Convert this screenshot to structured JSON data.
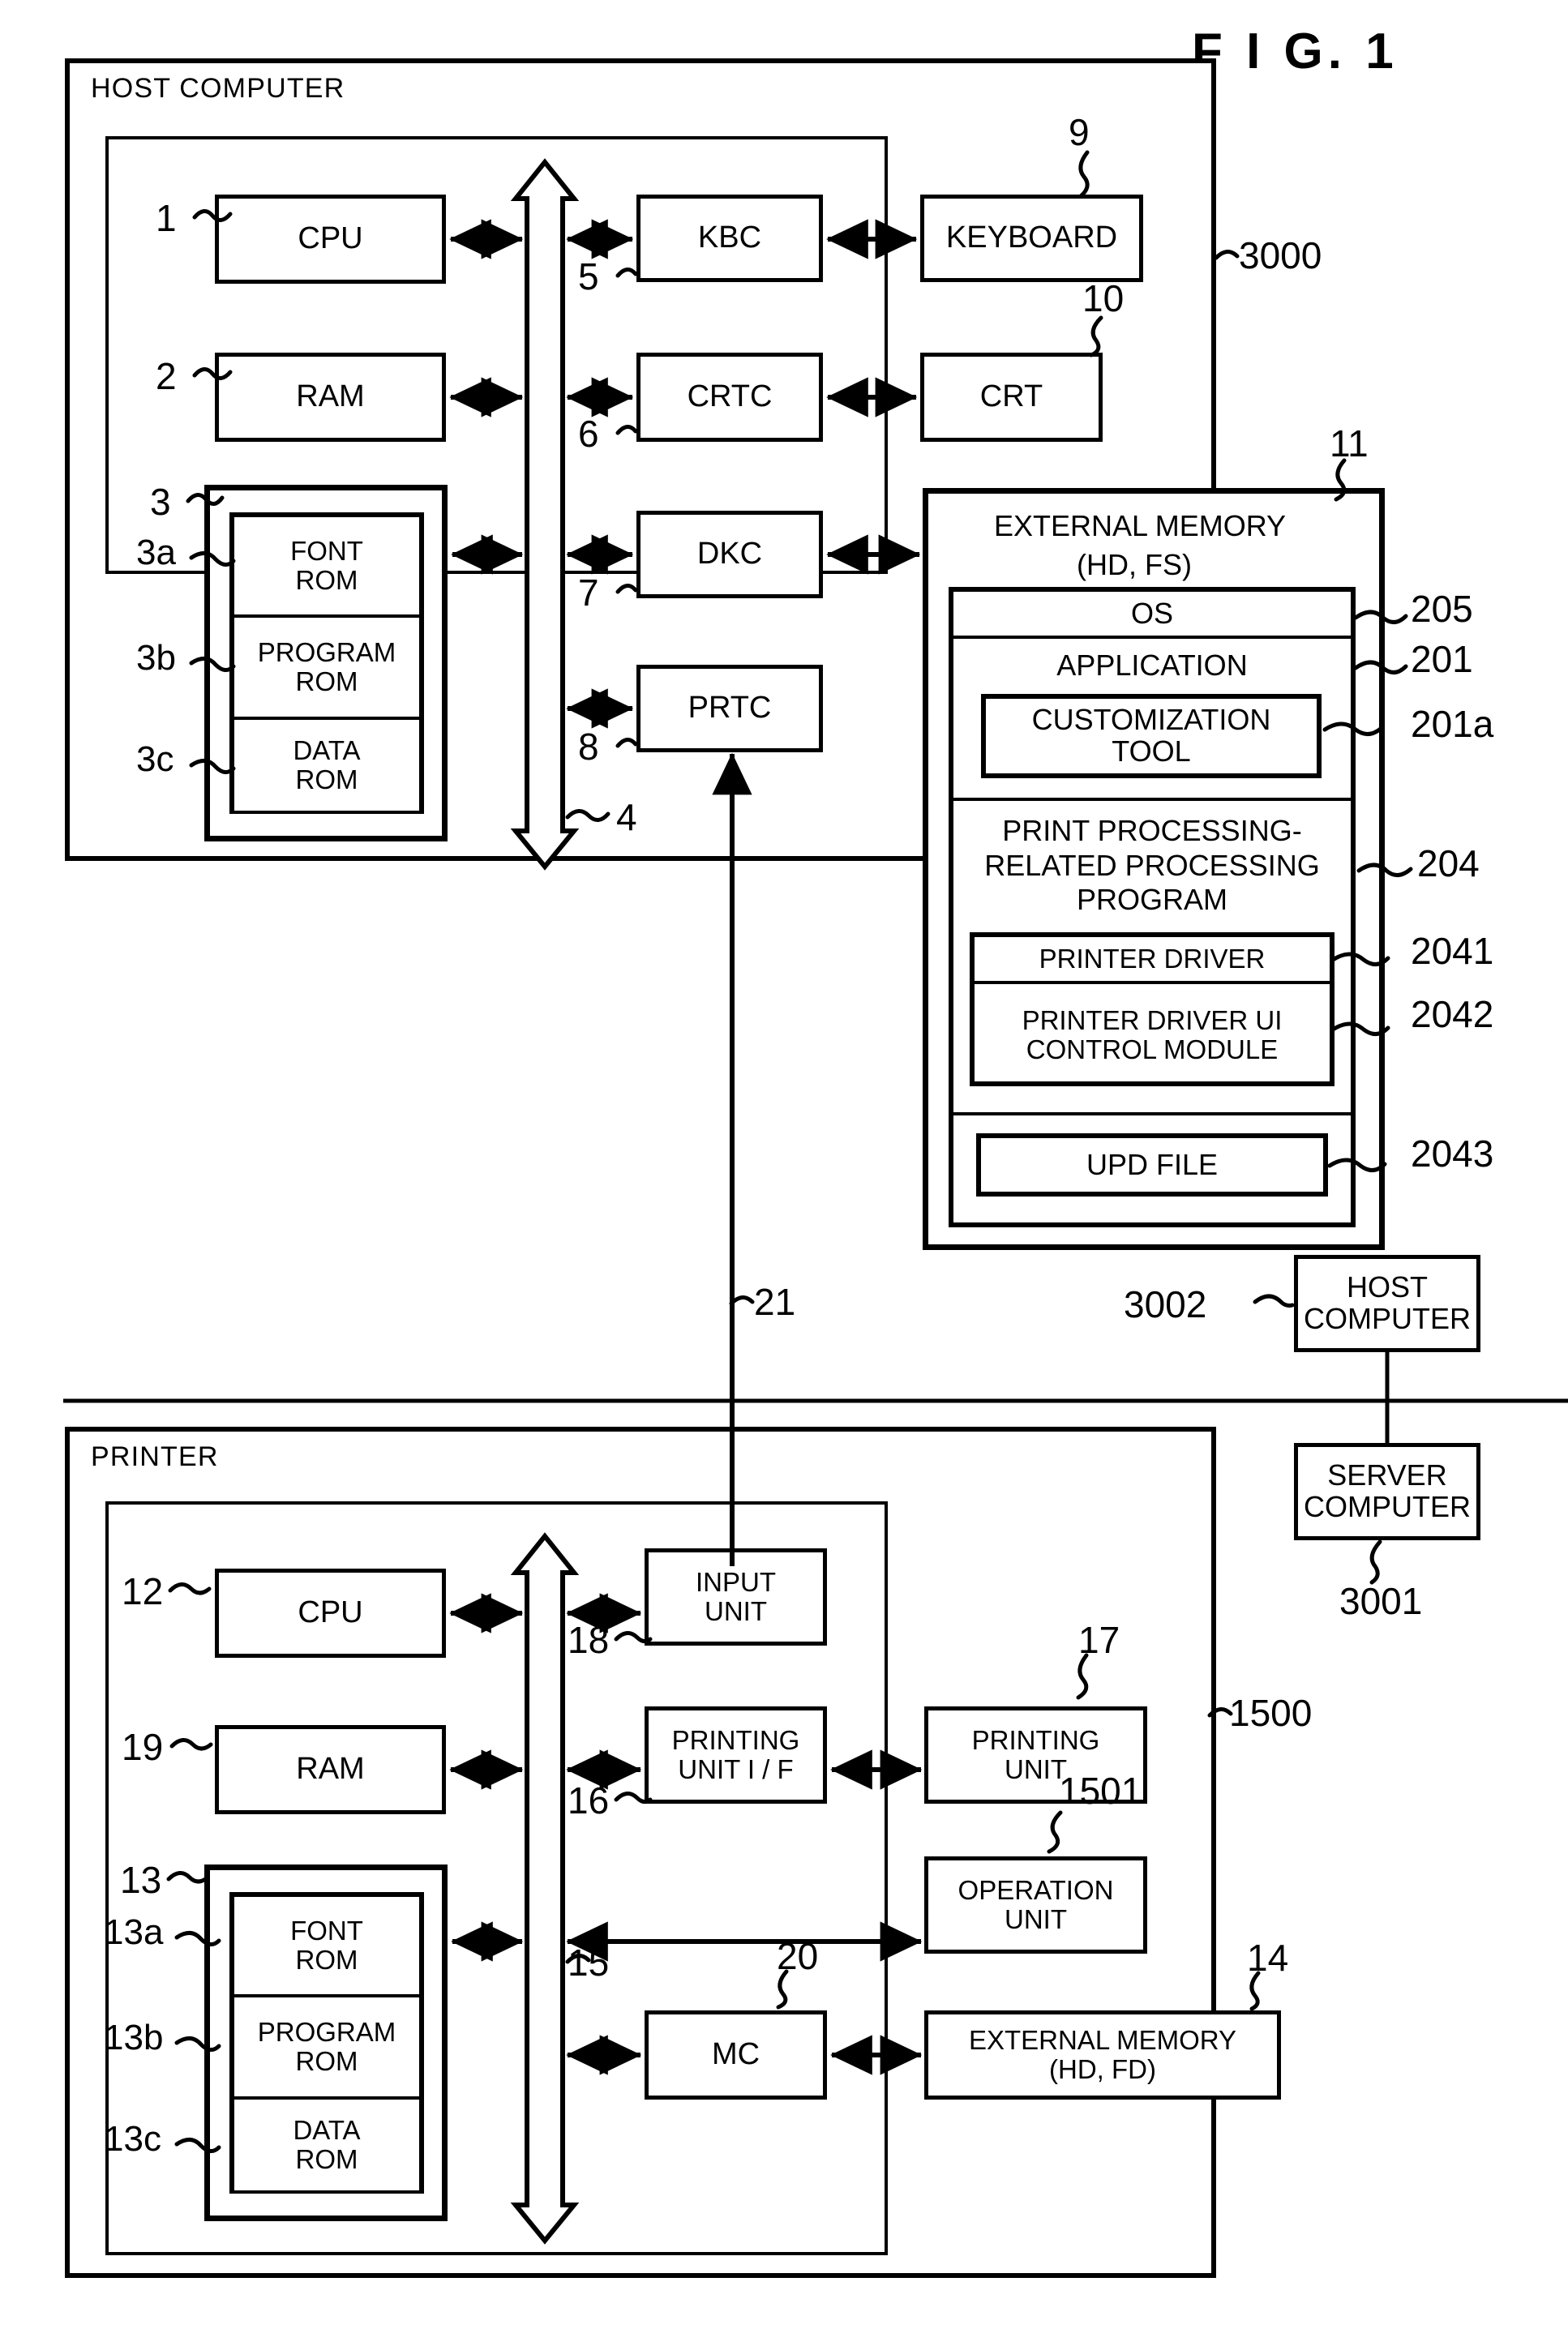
{
  "figure": {
    "title": "F I G.   1"
  },
  "host": {
    "caption": "HOST COMPUTER",
    "ref": "3000",
    "bus_ref": "4",
    "blocks": {
      "cpu": {
        "label": "CPU",
        "ref": "1"
      },
      "ram": {
        "label": "RAM",
        "ref": "2"
      },
      "rom_group_ref": "3",
      "font_rom": {
        "label": "FONT\nROM",
        "ref": "3a"
      },
      "program_rom": {
        "label": "PROGRAM\nROM",
        "ref": "3b"
      },
      "data_rom": {
        "label": "DATA\nROM",
        "ref": "3c"
      },
      "kbc": {
        "label": "KBC",
        "ref": "5"
      },
      "crtc": {
        "label": "CRTC",
        "ref": "6"
      },
      "dkc": {
        "label": "DKC",
        "ref": "7"
      },
      "prtc": {
        "label": "PRTC",
        "ref": "8"
      },
      "keyboard": {
        "label": "KEYBOARD",
        "ref": "9"
      },
      "crt": {
        "label": "CRT",
        "ref": "10"
      }
    },
    "external_memory": {
      "title_line1": "EXTERNAL MEMORY",
      "title_line2": "(HD, FS)",
      "ref": "11",
      "items": [
        {
          "label": "OS",
          "ref": "205"
        },
        {
          "label": "APPLICATION",
          "ref": "201"
        },
        {
          "label": "CUSTOMIZATION\nTOOL",
          "ref": "201a"
        },
        {
          "label": "PRINT PROCESSING-\nRELATED PROCESSING\nPROGRAM",
          "ref": "204"
        },
        {
          "label": "PRINTER DRIVER",
          "ref": "2041"
        },
        {
          "label": "PRINTER DRIVER UI\nCONTROL MODULE",
          "ref": "2042"
        },
        {
          "label": "UPD FILE",
          "ref": "2043"
        }
      ]
    }
  },
  "link": {
    "ref": "21"
  },
  "network": {
    "host_computer": {
      "label": "HOST\nCOMPUTER",
      "ref": "3002"
    },
    "server_computer": {
      "label": "SERVER\nCOMPUTER",
      "ref": "3001"
    }
  },
  "printer": {
    "caption": "PRINTER",
    "ref": "1500",
    "bus_ref": "15",
    "blocks": {
      "cpu": {
        "label": "CPU",
        "ref": "12"
      },
      "ram": {
        "label": "RAM",
        "ref": "19"
      },
      "rom_group_ref": "13",
      "font_rom": {
        "label": "FONT\nROM",
        "ref": "13a"
      },
      "program_rom": {
        "label": "PROGRAM\nROM",
        "ref": "13b"
      },
      "data_rom": {
        "label": "DATA\nROM",
        "ref": "13c"
      },
      "input_unit": {
        "label": "INPUT\nUNIT",
        "ref": "18"
      },
      "printing_unit_if": {
        "label": "PRINTING\nUNIT I / F",
        "ref": "16"
      },
      "printing_unit": {
        "label": "PRINTING\nUNIT",
        "ref": "17"
      },
      "operation_unit": {
        "label": "OPERATION\nUNIT",
        "ref": "1501"
      },
      "mc": {
        "label": "MC",
        "ref": "20"
      },
      "external_memory": {
        "label": "EXTERNAL MEMORY\n(HD, FD)",
        "ref": "14"
      }
    }
  },
  "colors": {
    "ink": "#000000",
    "paper": "#ffffff"
  }
}
